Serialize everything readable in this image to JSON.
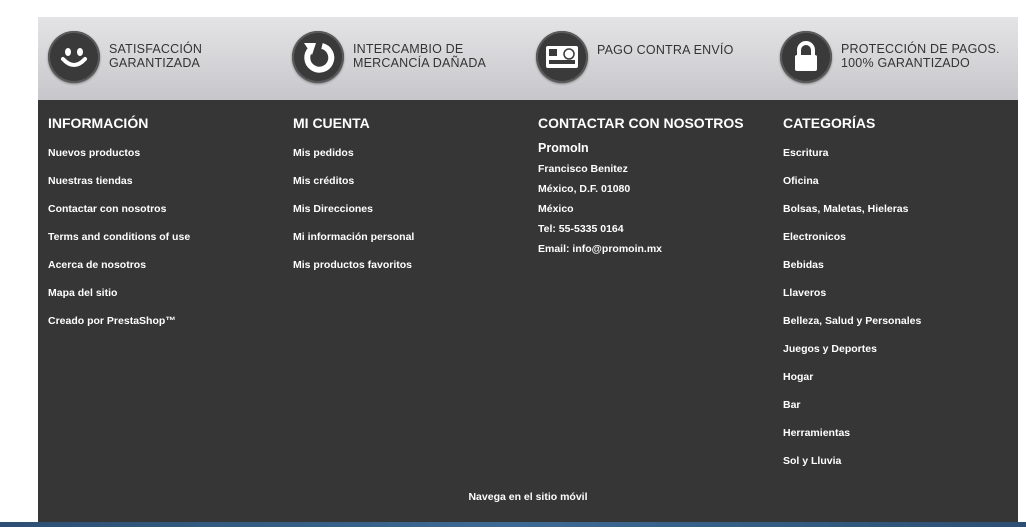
{
  "features": [
    {
      "icon": "smiley-icon",
      "text": "SATISFACCIÓN GARANTIZADA"
    },
    {
      "icon": "refresh-arrow-icon",
      "text": "INTERCAMBIO DE MERCANCÍA DAÑADA"
    },
    {
      "icon": "cash-payment-icon",
      "text": "PAGO CONTRA ENVÍO"
    },
    {
      "icon": "padlock-icon",
      "text": "PROTECCIÓN DE PAGOS. 100% GARANTIZADO"
    }
  ],
  "info": {
    "title": "INFORMACIÓN",
    "items": [
      "Nuevos productos",
      "Nuestras tiendas",
      "Contactar con nosotros",
      "Terms and conditions of use",
      "Acerca de nosotros",
      "Mapa del sitio",
      "Creado por PrestaShop™"
    ]
  },
  "account": {
    "title": "MI CUENTA",
    "items": [
      "Mis pedidos",
      "Mis créditos",
      "Mis Direcciones",
      "Mi información personal",
      "Mis productos favoritos"
    ]
  },
  "contact": {
    "title": "CONTACTAR CON NOSOTROS",
    "company": "PromoIn",
    "lines": [
      "Francisco Benitez",
      "México, D.F. 01080",
      "México",
      "Tel: 55-5335 0164",
      "Email: info@promoin.mx"
    ]
  },
  "categories": {
    "title": "CATEGORÍAS",
    "items": [
      "Escritura",
      "Oficina",
      "Bolsas, Maletas, Hieleras",
      "Electronicos",
      "Bebidas",
      "Llaveros",
      "Belleza, Salud y Personales",
      "Juegos y Deportes",
      "Hogar",
      "Bar",
      "Herramientas",
      "Sol y Lluvia"
    ]
  },
  "mobile_link": "Navega en el sitio móvil"
}
